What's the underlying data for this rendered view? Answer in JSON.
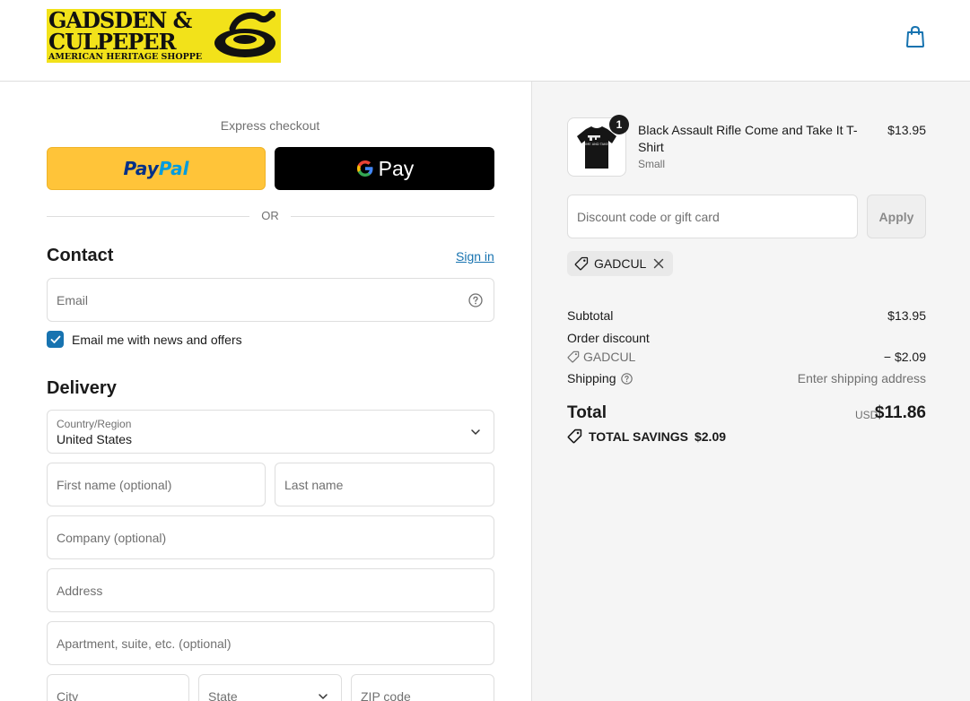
{
  "header": {
    "logo": {
      "line1": "GADSDEN &",
      "line2": "CULPEPER",
      "line3": "AMERICAN HERITAGE SHOPPE"
    },
    "cart_icon": "shopping-bag-icon"
  },
  "express": {
    "title": "Express checkout",
    "paypal_part1": "Pay",
    "paypal_part2": "Pal",
    "gpay_label": "Pay",
    "divider": "OR"
  },
  "contact": {
    "title": "Contact",
    "sign_in": "Sign in",
    "email_placeholder": "Email",
    "newsletter_label": "Email me with news and offers",
    "newsletter_checked": true
  },
  "delivery": {
    "title": "Delivery",
    "country_label": "Country/Region",
    "country_value": "United States",
    "first_name_placeholder": "First name (optional)",
    "last_name_placeholder": "Last name",
    "company_placeholder": "Company (optional)",
    "address_placeholder": "Address",
    "apartment_placeholder": "Apartment, suite, etc. (optional)",
    "city_placeholder": "City",
    "state_placeholder": "State",
    "zip_placeholder": "ZIP code"
  },
  "order": {
    "item": {
      "quantity": "1",
      "name": "Black Assault Rifle Come and Take It T-Shirt",
      "variant": "Small",
      "price": "$13.95",
      "shirt_print": "COME AND TAKE IT"
    },
    "discount_placeholder": "Discount code or gift card",
    "apply_label": "Apply",
    "applied_code": "GADCUL",
    "subtotal_label": "Subtotal",
    "subtotal_value": "$13.95",
    "order_discount_label": "Order discount",
    "discount_code": "GADCUL",
    "discount_value": "− $2.09",
    "shipping_label": "Shipping",
    "shipping_value": "Enter shipping address",
    "total_label": "Total",
    "total_currency": "USD",
    "total_value": "$11.86",
    "savings_label": "TOTAL SAVINGS",
    "savings_value": "$2.09"
  },
  "colors": {
    "accent": "#1773b0",
    "paypal_yellow": "#ffc439",
    "panel_bg": "#f5f5f5"
  }
}
